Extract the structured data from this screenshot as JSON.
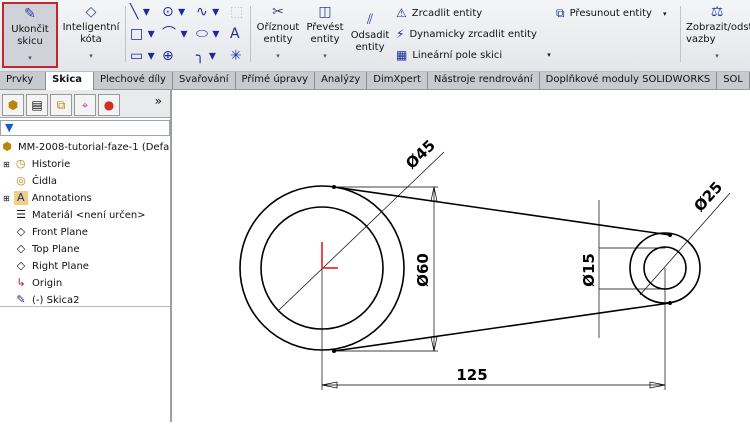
{
  "toolbar": {
    "exit_sketch": "Ukončit skicu",
    "smart_dimension": "Inteligentní kóta",
    "trim": "Oříznout entity",
    "convert": "Převést entity",
    "offset": "Odsadit entity",
    "mirror": "Zrcadlit entity",
    "dyn_mirror": "Dynamicky zrcadlit entity",
    "linear_pattern": "Lineární pole skici",
    "move": "Přesunout entity",
    "relations": "Zobrazit/odstranit vazby"
  },
  "tabs": [
    "Prvky",
    "Skica",
    "Plechové díly",
    "Svařování",
    "Přímé úpravy",
    "Analýzy",
    "DimXpert",
    "Nástroje rendrování",
    "Doplňkové moduly SOLIDWORKS",
    "SOL"
  ],
  "active_tab": "Skica",
  "tree": {
    "root": "MM-2008-tutorial-faze-1  (Defa",
    "items": [
      "Historie",
      "Čidla",
      "Annotations",
      "Materiál <není určen>",
      "Front Plane",
      "Top Plane",
      "Right Plane",
      "Origin",
      "(-) Skica2"
    ]
  },
  "drawing": {
    "dim_45": "Ø45",
    "dim_60": "Ø60",
    "dim_15": "Ø15",
    "dim_25": "Ø25",
    "dim_125": "125"
  },
  "colors": {
    "accent": "#c3272b",
    "origin": "#e01010"
  }
}
